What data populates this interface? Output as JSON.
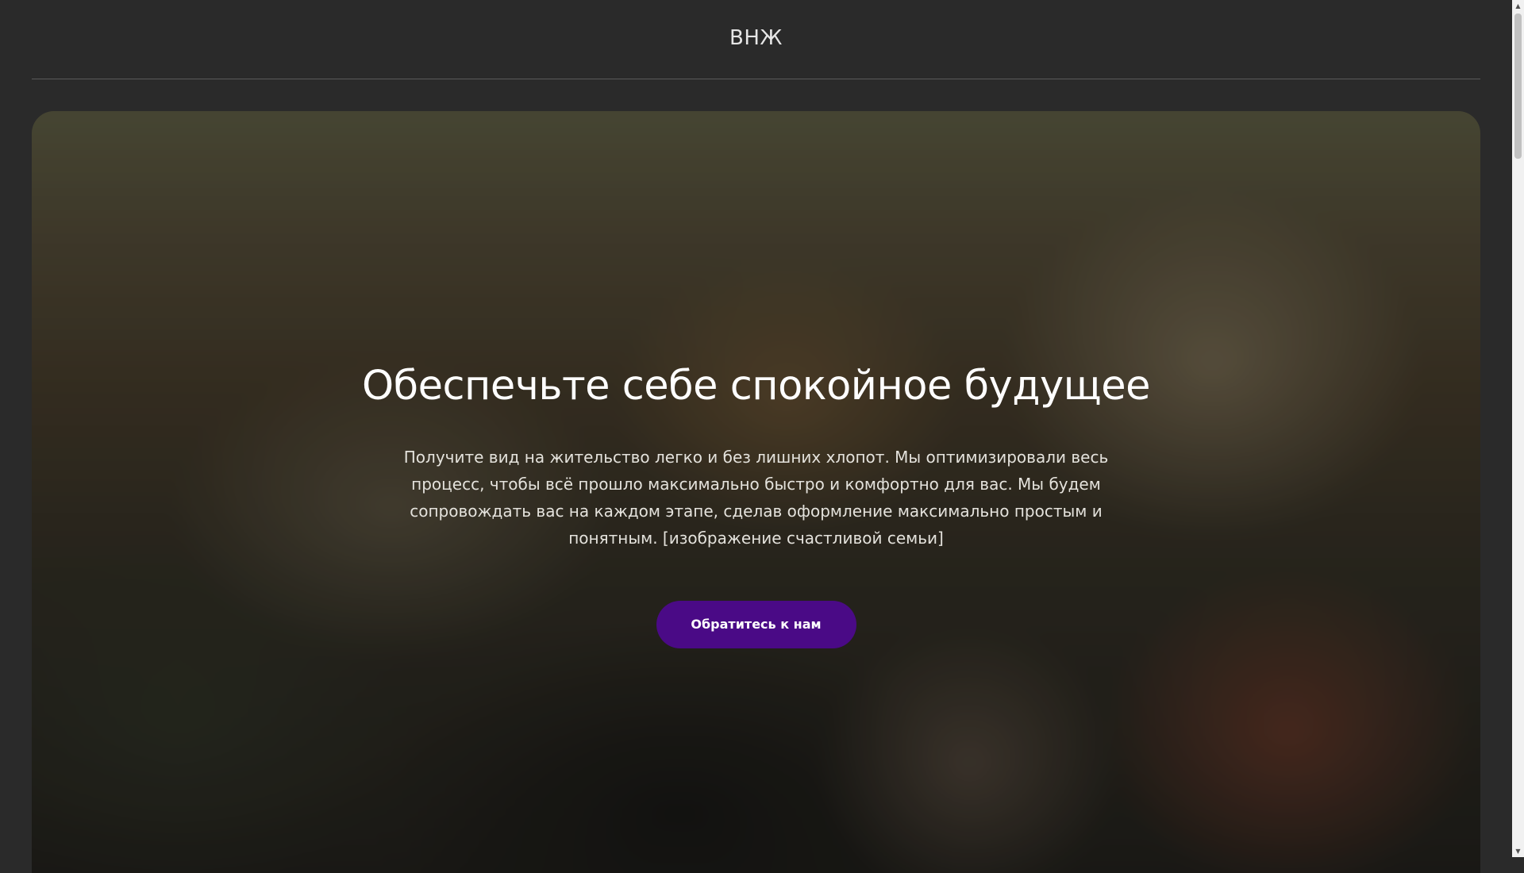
{
  "header": {
    "logo_text": "ВНЖ"
  },
  "hero": {
    "background_description_icon": "blurred-family-photo",
    "title": "Обеспечьте себе спокойное будущее",
    "text": "Получите вид на жительство легко и без лишних хлопот. Мы оптимизировали весь процесс, чтобы всё прошло максимально быстро и комфортно для вас. Мы будем сопровождать вас на каждом этапе, сделав оформление максимально простым и понятным. [изображение счастливой семьи]",
    "cta_label": "Обратитесь к нам"
  },
  "colors": {
    "page_background": "#2a2a2a",
    "cta_background": "#4a0a86",
    "text_primary": "#ffffff"
  },
  "scrollbar": {
    "up_icon": "triangle-up",
    "down_icon": "triangle-down"
  }
}
